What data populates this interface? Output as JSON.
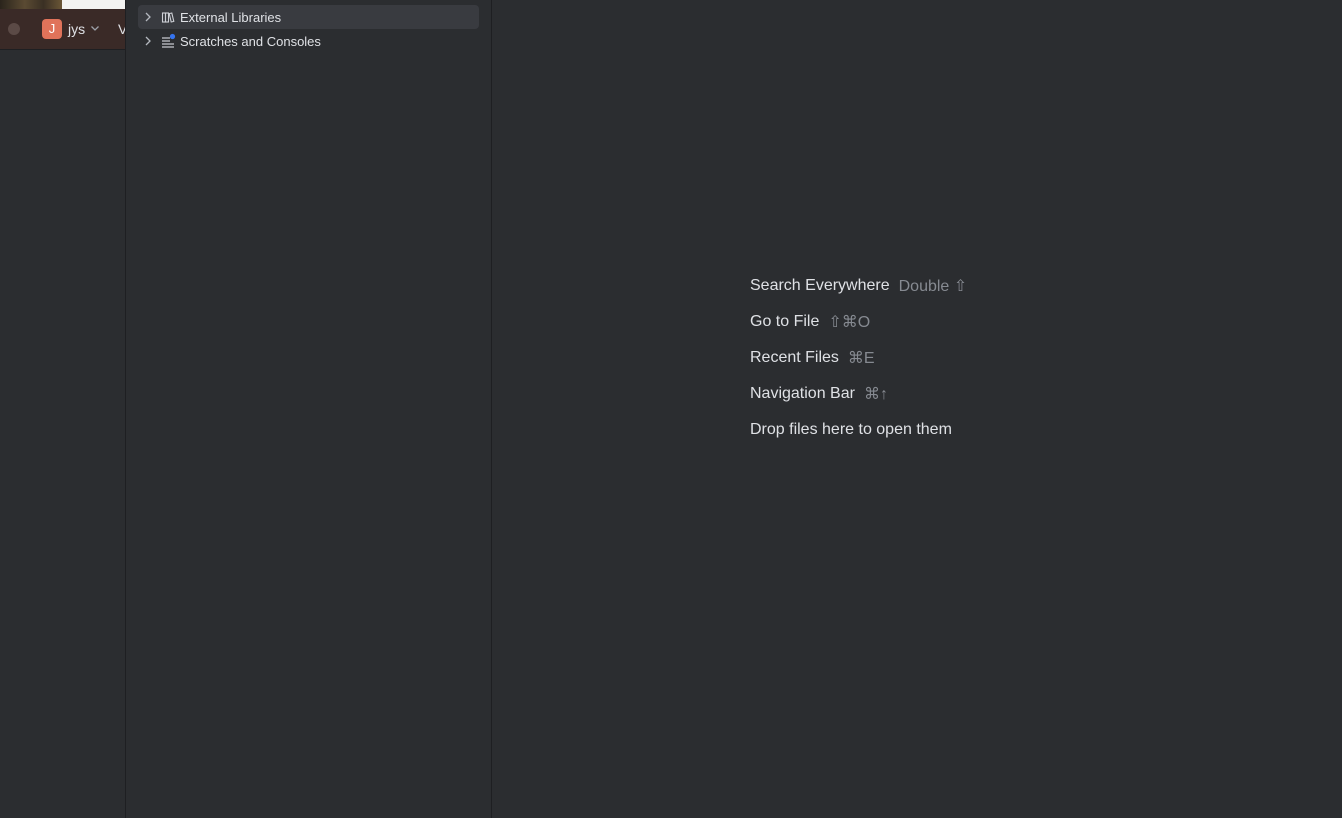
{
  "background_window": {
    "project_initial": "J",
    "project_name": "jys",
    "vcs_label_fragment": "V"
  },
  "project_tree": {
    "items": [
      {
        "label": "External Libraries",
        "icon": "library-icon",
        "selected": true
      },
      {
        "label": "Scratches and Consoles",
        "icon": "scratches-icon",
        "selected": false
      }
    ]
  },
  "editor_empty_state": {
    "hints": [
      {
        "label": "Search Everywhere",
        "shortcut": "Double ⇧"
      },
      {
        "label": "Go to File",
        "shortcut": "⇧⌘O"
      },
      {
        "label": "Recent Files",
        "shortcut": "⌘E"
      },
      {
        "label": "Navigation Bar",
        "shortcut": "⌘↑"
      },
      {
        "label": "Drop files here to open them",
        "shortcut": ""
      }
    ]
  },
  "colors": {
    "background": "#2b2d30",
    "selection": "#393b40",
    "text": "#dfe1e5",
    "muted_text": "#868a91",
    "project_badge": "#e0735a",
    "toolbar_tint": "#3a2a27"
  }
}
